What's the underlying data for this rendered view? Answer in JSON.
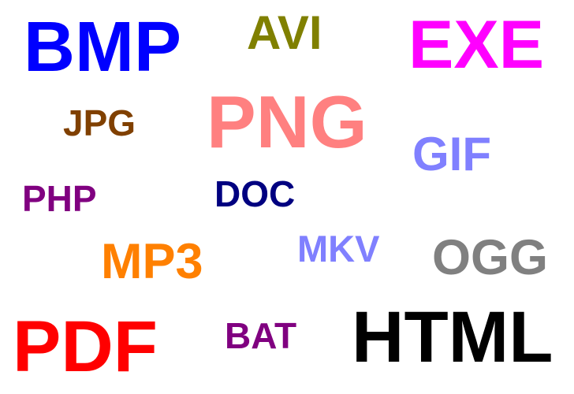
{
  "words": {
    "bmp": {
      "text": "BMP",
      "color": "#0000ff"
    },
    "avi": {
      "text": "AVI",
      "color": "#808000"
    },
    "exe": {
      "text": "EXE",
      "color": "#ff00ff"
    },
    "jpg": {
      "text": "JPG",
      "color": "#804000"
    },
    "png": {
      "text": "PNG",
      "color": "#ff8080"
    },
    "gif": {
      "text": "GIF",
      "color": "#8080ff"
    },
    "php": {
      "text": "PHP",
      "color": "#800080"
    },
    "doc": {
      "text": "DOC",
      "color": "#000080"
    },
    "mp3": {
      "text": "MP3",
      "color": "#ff8000"
    },
    "mkv": {
      "text": "MKV",
      "color": "#8080ff"
    },
    "ogg": {
      "text": "OGG",
      "color": "#808080"
    },
    "pdf": {
      "text": "PDF",
      "color": "#ff0000"
    },
    "bat": {
      "text": "BAT",
      "color": "#800080"
    },
    "html": {
      "text": "HTML",
      "color": "#000000"
    }
  }
}
